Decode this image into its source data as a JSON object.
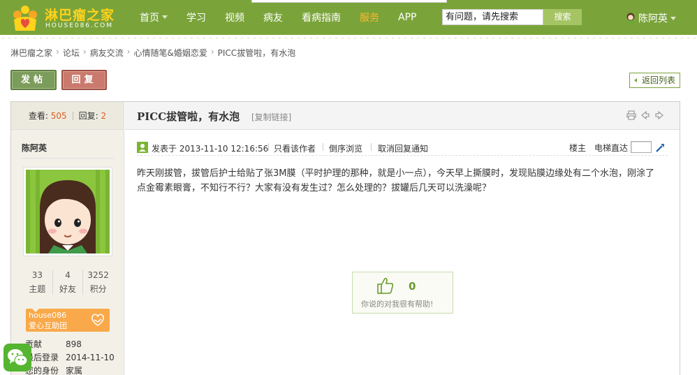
{
  "site": {
    "name": "淋巴瘤之家",
    "domain": "HOUSE086.COM",
    "colors": {
      "nav_bg": "#7aa43a",
      "logo_yellow": "#ffd21c",
      "active_orange": "#ffb82b",
      "count_red": "#e15a23"
    }
  },
  "nav": {
    "items": [
      {
        "label": "首页",
        "dropdown": true
      },
      {
        "label": "学习"
      },
      {
        "label": "视频"
      },
      {
        "label": "病友"
      },
      {
        "label": "看病指南"
      },
      {
        "label": "服务",
        "active": true
      },
      {
        "label": "APP"
      }
    ]
  },
  "search": {
    "value": "有问题，请先搜索",
    "button_label": "搜索"
  },
  "user": {
    "name": "陈阿英",
    "icon": "user-avatar-icon"
  },
  "breadcrumb": [
    "淋巴瘤之家",
    "论坛",
    "病友交流",
    "心情随笔&婚姻恋爱",
    "PICC拔管啦，有水泡"
  ],
  "actions": {
    "post_label": "发帖",
    "reply_label": "回复",
    "back_label": "返回列表"
  },
  "thread": {
    "views_label": "查看:",
    "views": "505",
    "replies_label": "回复:",
    "replies": "2",
    "title": "PICC拔管啦，有水泡",
    "copy_link": "[复制链接]",
    "tools": [
      "print-icon",
      "prev-thread-icon",
      "next-thread-icon"
    ]
  },
  "author": {
    "name": "陈阿英",
    "stats": [
      {
        "value": "33",
        "label": "主题"
      },
      {
        "value": "4",
        "label": "好友"
      },
      {
        "value": "3252",
        "label": "积分"
      }
    ],
    "badge": {
      "line1": "house086",
      "line2": "爱心互助团"
    },
    "info": [
      {
        "key": "贡献",
        "value": "898"
      },
      {
        "key": "最后登录",
        "value": "2014-11-10"
      },
      {
        "key": "您的身份",
        "value": "家属"
      }
    ]
  },
  "post": {
    "posted_at": "发表于 2013-11-10 12:16:56",
    "only_author": "只看该作者",
    "reverse": "倒序浏览",
    "cancel_notify": "取消回复通知",
    "floor": "楼主",
    "jump_label": "电梯直达",
    "body": "昨天刚拔管，拔管后护士给贴了张3M膜（平时护理的那种，就是小一点），今天早上撕膜时，发现贴膜边缘处有二个水泡，刚涂了点金霉素眼膏，不知行不行？大家有没有发生过？怎么处理的？拔罐后几天可以洗澡呢？",
    "help_count": "0",
    "help_label": "你说的对我很有帮助!"
  }
}
